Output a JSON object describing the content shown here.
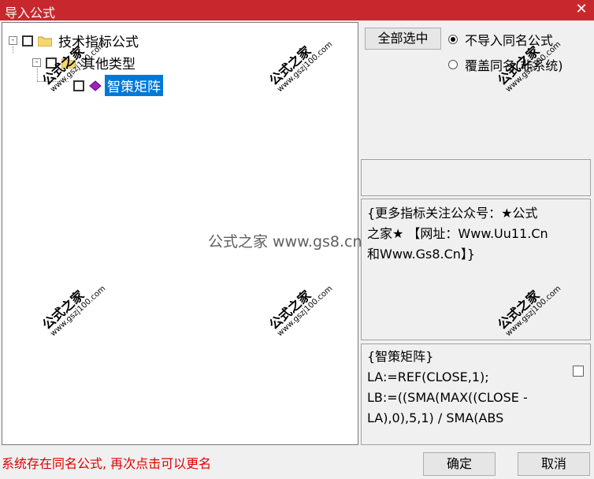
{
  "window": {
    "title": "导入公式",
    "close_symbol": "✕"
  },
  "tree": {
    "root": {
      "label": "技术指标公式",
      "expander": "-"
    },
    "child": {
      "label": "其他类型",
      "expander": "-"
    },
    "leaf": {
      "label": "智策矩阵"
    }
  },
  "options": {
    "select_all_label": "全部选中",
    "radios": [
      {
        "label": "不导入同名公式",
        "checked": true
      },
      {
        "label": "覆盖同名(非系统)",
        "checked": false
      }
    ]
  },
  "info": {
    "line1": "{更多指标关注公众号：★公式",
    "line2": "之家★ 【网址：Www.Uu11.Cn",
    "line3": "和Www.Gs8.Cn】}"
  },
  "formula": {
    "line1": "{智策矩阵}",
    "line2": "LA:=REF(CLOSE,1);",
    "line3": "LB:=((SMA(MAX((CLOSE -",
    "line4": "LA),0),5,1) / SMA(ABS"
  },
  "status": {
    "message": "系统存在同名公式, 再次点击可以更名"
  },
  "buttons": {
    "ok": "确定",
    "cancel": "取消"
  },
  "watermark": {
    "center": "公式之家 www.gs8.cn",
    "tile_title": "公式之家",
    "tile_url": "www.gszj100.com"
  }
}
